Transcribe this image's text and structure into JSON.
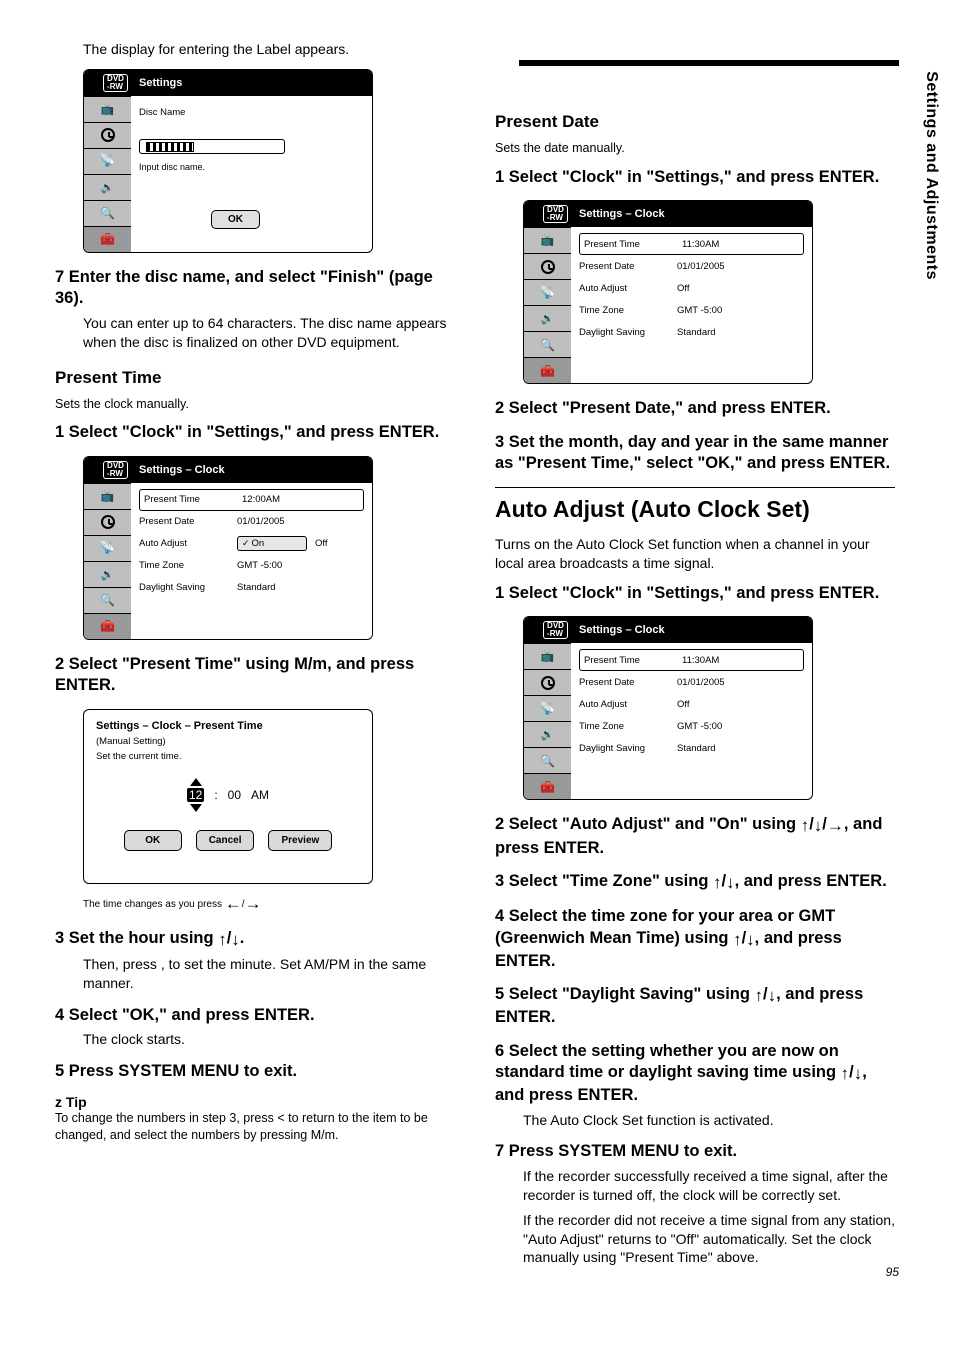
{
  "side_label": "Settings and Adjustments",
  "page_number": "95",
  "left": {
    "intro": "The display for entering the Label appears.",
    "row_label_name": "Disc Name",
    "input_hint": "Input disc name.",
    "ok_label": "OK",
    "step7_head": "7 Enter the disc name, and select \"Finish\" (page 36).",
    "step7_body": "You can enter up to 64 characters. The disc name appears when the disc is finalized on other DVD equipment.",
    "subsection1": "Present Time",
    "sub1_p1": "Sets the clock manually.",
    "sub1_step1_head": "1 Select \"Clock\" in \"Settings,\" and press ENTER.",
    "row1_k": "Present Time",
    "row1_v": "12:00AM",
    "row2_k": "Present Date",
    "row2_v": "01/01/2005",
    "row3_k": "Auto Adjust",
    "row3_sel": "On",
    "row3_v2": "Off",
    "row4_k": "Time Zone",
    "row4_v": "GMT -5:00",
    "row5_k": "Daylight Saving",
    "row5_v": "Standard",
    "sub1_step2_head": "2 Select \"Present Time\" using M/m, and press ENTER.",
    "clock_dialog": {
      "title": "Settings – Clock – Present Time",
      "sub": "(Manual Setting)",
      "prompt": "Set the current time.",
      "segs": [
        "12",
        ":",
        "00",
        "AM"
      ],
      "ok": "OK",
      "cancel": "Cancel",
      "preview": "Preview",
      "caption": "The time changes as you press"
    },
    "sub1_step3_head": "3 Set the hour using M/m.",
    "sub1_step3_body": "Then, press , to set the minute. Set AM/PM in the same manner.",
    "sub1_step4_head": "4 Select \"OK,\" and press ENTER.",
    "sub1_step4_body": "The clock starts.",
    "sub1_step5_head": "5 Press SYSTEM MENU to exit.",
    "tip_head": "z Tip",
    "tip_body": "To change the numbers in step 3, press < to return to the item to be changed, and select the numbers by pressing M/m."
  },
  "right": {
    "subsection2": "Present Date",
    "sub2_p1": "Sets the date manually.",
    "sub2_step1_head": "1 Select \"Clock\" in \"Settings,\" and press ENTER.",
    "row1_k": "Present Time",
    "row1_v": "11:30AM",
    "row2_k": "Present Date",
    "row2_v": "01/01/2005",
    "row3_k": "Auto Adjust",
    "row3_v": "Off",
    "row4_k": "Time Zone",
    "row4_v": "GMT -5:00",
    "row5_k": "Daylight Saving",
    "row5_v": "Standard",
    "sub2_step2_head": "2 Select \"Present Date,\" and press ENTER.",
    "sub2_step3_head": "3 Set the month, day and year in the same manner as \"Present Time,\" select \"OK,\" and press ENTER.",
    "section_title": "Auto Adjust (Auto Clock Set)",
    "section_p1": "Turns on the Auto Clock Set function when a channel in your local area broadcasts a time signal.",
    "as_step1_head": "1 Select \"Clock\" in \"Settings,\" and press ENTER.",
    "as_row1_k": "Present Time",
    "as_row1_v": "11:30AM",
    "as_row2_k": "Present Date",
    "as_row2_v": "01/01/2005",
    "as_row3_k": "Auto Adjust",
    "as_row3_v": "Off",
    "as_row4_k": "Time Zone",
    "as_row4_v": "GMT -5:00",
    "as_row5_k": "Daylight Saving",
    "as_row5_v": "Standard",
    "as_step2_head": "2 Select \"Auto Adjust\" and \"On\" using M/m/,, and press ENTER.",
    "as_step3_head": "3 Select \"Time Zone\" using M/m, and press ENTER.",
    "as_step4_head": "4 Select the time zone for your area or GMT (Greenwich Mean Time) using M/m, and press ENTER.",
    "as_step5_head": "5 Select \"Daylight Saving\" using M/m, and press ENTER.",
    "as_step6_head": "6 Select the setting whether you are now on standard time or daylight saving time using M/m, and press ENTER.",
    "as_step6_body": "The Auto Clock Set function is activated.",
    "as_step7_head": "7 Press SYSTEM MENU to exit.",
    "as_step7_body1": "If the recorder successfully received a time signal, after the recorder is turned off, the clock will be correctly set.",
    "as_step7_body2": "If the recorder did not receive a time signal from any station, \"Auto Adjust\" returns to \"Off\" automatically. Set the clock manually using \"Present Time\" above."
  },
  "screens": {
    "settings_title": "Settings",
    "clock_title": "Settings – Clock"
  }
}
